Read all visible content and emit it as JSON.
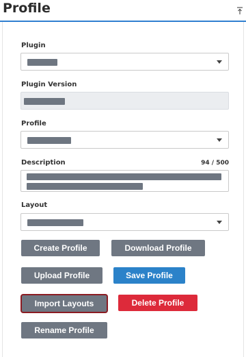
{
  "header": {
    "title": "Profile",
    "pin_icon": "pin-icon"
  },
  "form": {
    "plugin_label": "Plugin",
    "plugin_version_label": "Plugin Version",
    "profile_label": "Profile",
    "description_label": "Description",
    "description_counter": "94 / 500",
    "layout_label": "Layout"
  },
  "buttons": {
    "create_profile": "Create Profile",
    "download_profile": "Download Profile",
    "upload_profile": "Upload Profile",
    "save_profile": "Save Profile",
    "import_layouts": "Import Layouts",
    "delete_profile": "Delete Profile",
    "rename_profile": "Rename Profile"
  },
  "colors": {
    "accent": "#2f7fd0",
    "button_gray": "#6f7782",
    "button_blue": "#2b82c9",
    "button_red": "#dd2a3a",
    "redaction": "#6e7681"
  }
}
